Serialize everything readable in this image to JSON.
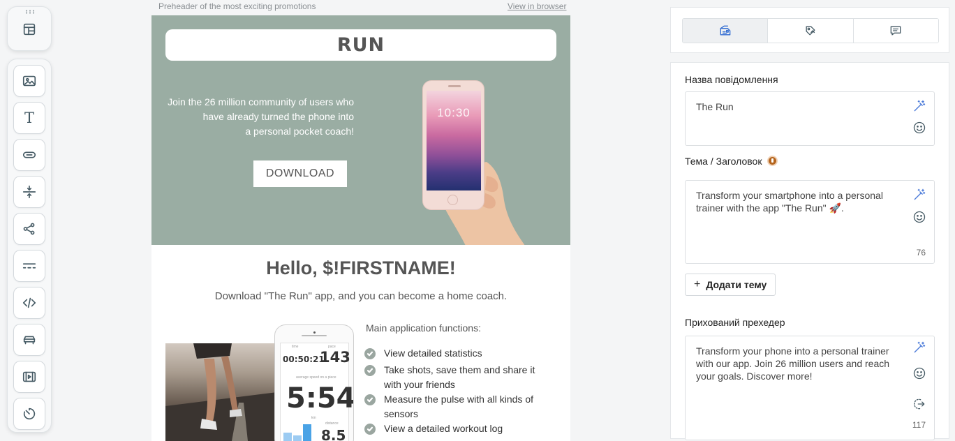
{
  "email": {
    "preheader": "Preheader of the most exciting promotions",
    "view_in_browser": "View in browser",
    "logo": "RUN",
    "hero_lines": [
      "Join the 26 million community of users who",
      "have already turned the phone into",
      "a personal pocket coach!"
    ],
    "download_label": "DOWNLOAD",
    "phone_clock": "10:30",
    "greeting": "Hello, $!FIRSTNAME!",
    "subtitle": "Download \"The Run\" app, and you can become a home coach.",
    "app_screen": {
      "time_label": "time",
      "time_value": "00:50:21",
      "pace_label": "pace",
      "pace_value": "143",
      "speed_label": "average speed on a piece",
      "speed_value": "5:54",
      "unit_label": "km",
      "distance_label": "distance",
      "distance_value": "8.5"
    },
    "functions_title": "Main application functions:",
    "functions": [
      {
        "text": "View detailed statistics"
      },
      {
        "text": "Take shots, save them and share it with your friends"
      },
      {
        "text": "Measure the pulse with all kinds of sensors"
      },
      {
        "text": "View a detailed workout log"
      }
    ]
  },
  "toolbar": {
    "tools": [
      {
        "icon": "layout-icon"
      },
      {
        "icon": "image-icon"
      },
      {
        "icon": "text-icon",
        "glyph": "T"
      },
      {
        "icon": "button-icon"
      },
      {
        "icon": "spacer-icon"
      },
      {
        "icon": "share-icon"
      },
      {
        "icon": "divider-icon"
      },
      {
        "icon": "code-icon"
      },
      {
        "icon": "product-icon"
      },
      {
        "icon": "video-icon"
      },
      {
        "icon": "timer-icon"
      }
    ]
  },
  "settings": {
    "tabs": [
      {
        "icon": "email-settings-icon",
        "active": true
      },
      {
        "icon": "tag-icon",
        "active": false
      },
      {
        "icon": "comment-icon",
        "active": false
      }
    ],
    "message_name_label": "Назва повідомлення",
    "message_name_value": "The Run",
    "subject_label": "Тема / Заголовок",
    "subject_value": "Transform your smartphone into a personal trainer with the app \"The Run\" 🚀.",
    "subject_count": "76",
    "add_subject_label": "Додати тему",
    "preheader_label": "Прихований прехедер",
    "preheader_value": "Transform your phone into a personal trainer with our app. Join 26 million users and reach your goals. Discover more!",
    "preheader_count": "117"
  },
  "colors": {
    "hero_bg": "#9aada3",
    "accent": "#2e6ad1",
    "warning": "#b5651d"
  }
}
